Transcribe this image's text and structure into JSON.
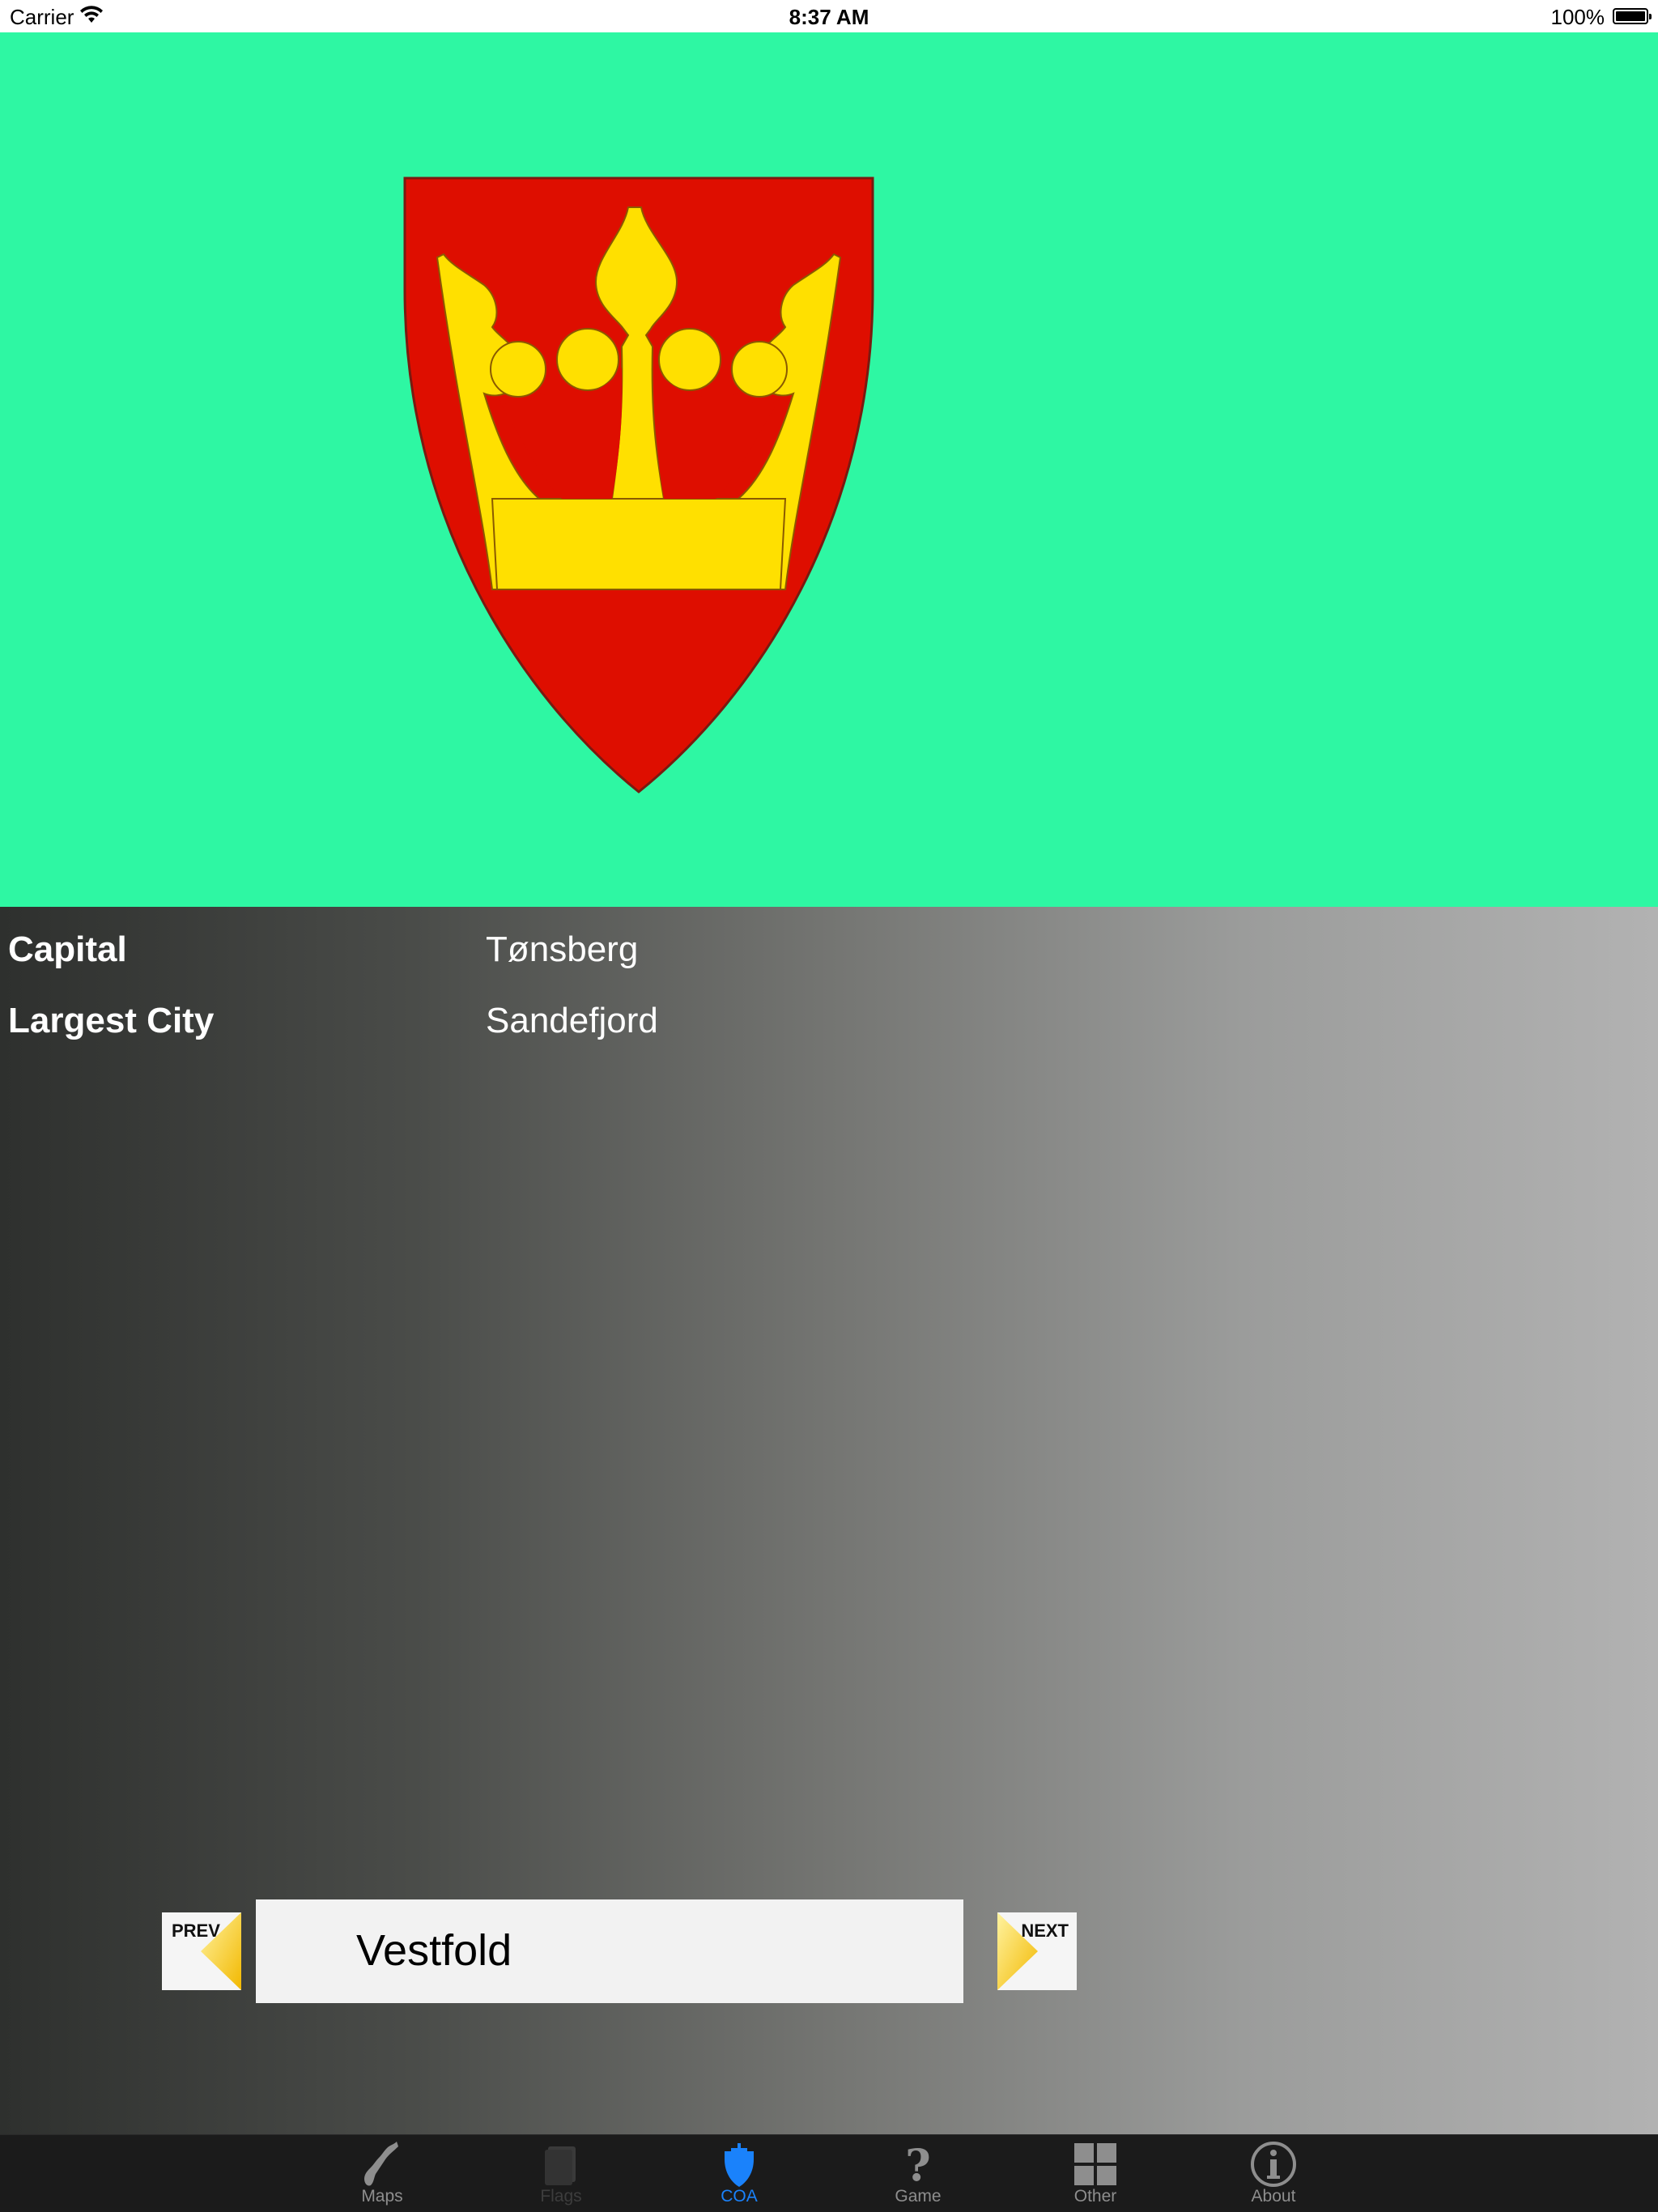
{
  "status_bar": {
    "carrier": "Carrier",
    "time": "8:37 AM",
    "battery": "100%"
  },
  "coat_of_arms": {
    "icon": "crown-shield-icon",
    "shield_color": "#de0e00",
    "crown_color": "#ffe000",
    "background_color": "#2ef7a3"
  },
  "info": {
    "capital_label": "Capital",
    "capital_value": "Tønsberg",
    "largest_city_label": "Largest City",
    "largest_city_value": "Sandefjord"
  },
  "navigation": {
    "prev_label": "PREV",
    "next_label": "NEXT",
    "current_name": "Vestfold"
  },
  "tab_bar": {
    "items": [
      {
        "label": "Maps",
        "icon": "norway-map-icon",
        "state": "normal"
      },
      {
        "label": "Flags",
        "icon": "flag-book-icon",
        "state": "disabled"
      },
      {
        "label": "COA",
        "icon": "shield-icon",
        "state": "active"
      },
      {
        "label": "Game",
        "icon": "question-mark-icon",
        "state": "normal"
      },
      {
        "label": "Other",
        "icon": "grid-icon",
        "state": "normal"
      },
      {
        "label": "About",
        "icon": "info-icon",
        "state": "normal"
      }
    ],
    "active_color": "#1a82fb"
  }
}
